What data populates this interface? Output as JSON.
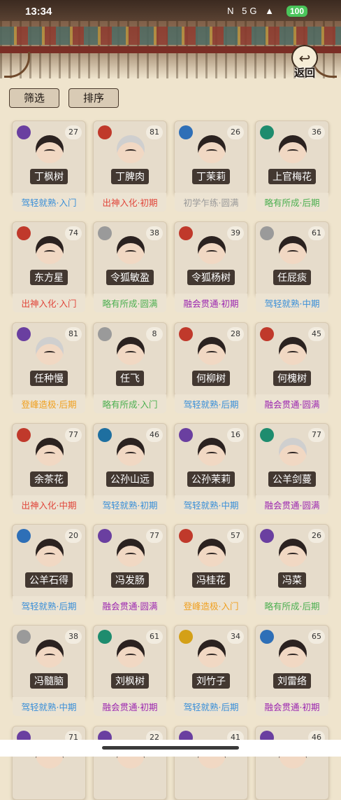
{
  "status": {
    "time": "13:34",
    "icons": "N  5G  ▲",
    "battery": "100"
  },
  "back": {
    "label": "返回",
    "icon": "back-arrow-icon"
  },
  "controls": {
    "filter": "筛选",
    "sort": "排序"
  },
  "colors": {
    "初学乍练": "#999999",
    "略有所成": "#4caf50",
    "驾轻就熟": "#3a8fd8",
    "融会贯通": "#9c27b0",
    "出神入化": "#e0453a",
    "登峰造极": "#f0a020"
  },
  "cards": [
    {
      "name": "丁枫树",
      "level": "27",
      "rank": "驾轻就熟·入门",
      "color": "#3a8fd8",
      "badge": "#6a3fa0",
      "hair": "dark"
    },
    {
      "name": "丁脾肉",
      "level": "81",
      "rank": "出神入化·初期",
      "color": "#e0453a",
      "badge": "#c0392b",
      "hair": "silver"
    },
    {
      "name": "丁茉莉",
      "level": "26",
      "rank": "初学乍练·圆满",
      "color": "#999999",
      "badge": "#2e6fb7",
      "hair": "dark"
    },
    {
      "name": "上官梅花",
      "level": "36",
      "rank": "略有所成·后期",
      "color": "#4caf50",
      "badge": "#1e8c6e",
      "hair": "dark"
    },
    {
      "name": "东方星",
      "level": "74",
      "rank": "出神入化·入门",
      "color": "#e0453a",
      "badge": "#c0392b",
      "hair": "dark"
    },
    {
      "name": "令狐敏盈",
      "level": "38",
      "rank": "略有所成·圆满",
      "color": "#4caf50",
      "badge": "#9a9a9a",
      "hair": "dark"
    },
    {
      "name": "令狐杨树",
      "level": "39",
      "rank": "融会贯通·初期",
      "color": "#9c27b0",
      "badge": "#c0392b",
      "hair": "dark"
    },
    {
      "name": "任屁痰",
      "level": "61",
      "rank": "驾轻就熟·中期",
      "color": "#3a8fd8",
      "badge": "#9a9a9a",
      "hair": "dark"
    },
    {
      "name": "任种慢",
      "level": "81",
      "rank": "登峰造极·后期",
      "color": "#f0a020",
      "badge": "#6a3fa0",
      "hair": "silver"
    },
    {
      "name": "任飞",
      "level": "8",
      "rank": "略有所成·入门",
      "color": "#4caf50",
      "badge": "#9a9a9a",
      "hair": "dark"
    },
    {
      "name": "何柳树",
      "level": "28",
      "rank": "驾轻就熟·后期",
      "color": "#3a8fd8",
      "badge": "#c0392b",
      "hair": "dark"
    },
    {
      "name": "何槐树",
      "level": "45",
      "rank": "融会贯通·圆满",
      "color": "#9c27b0",
      "badge": "#c0392b",
      "hair": "dark"
    },
    {
      "name": "余茶花",
      "level": "77",
      "rank": "出神入化·中期",
      "color": "#e0453a",
      "badge": "#c0392b",
      "hair": "dark"
    },
    {
      "name": "公孙山远",
      "level": "46",
      "rank": "驾轻就熟·初期",
      "color": "#3a8fd8",
      "badge": "#1e6fa0",
      "hair": "dark"
    },
    {
      "name": "公孙茉莉",
      "level": "16",
      "rank": "驾轻就熟·中期",
      "color": "#3a8fd8",
      "badge": "#6a3fa0",
      "hair": "dark"
    },
    {
      "name": "公羊剑蔓",
      "level": "77",
      "rank": "融会贯通·圆满",
      "color": "#9c27b0",
      "badge": "#1e8c6e",
      "hair": "silver"
    },
    {
      "name": "公羊石得",
      "level": "20",
      "rank": "驾轻就熟·后期",
      "color": "#3a8fd8",
      "badge": "#2e6fb7",
      "hair": "dark"
    },
    {
      "name": "冯发肠",
      "level": "77",
      "rank": "融会贯通·圆满",
      "color": "#9c27b0",
      "badge": "#6a3fa0",
      "hair": "dark"
    },
    {
      "name": "冯桂花",
      "level": "57",
      "rank": "登峰造极·入门",
      "color": "#f0a020",
      "badge": "#c0392b",
      "hair": "dark"
    },
    {
      "name": "冯菜",
      "level": "26",
      "rank": "略有所成·后期",
      "color": "#4caf50",
      "badge": "#6a3fa0",
      "hair": "dark"
    },
    {
      "name": "冯髓脑",
      "level": "38",
      "rank": "驾轻就熟·中期",
      "color": "#3a8fd8",
      "badge": "#9a9a9a",
      "hair": "dark"
    },
    {
      "name": "刘枫树",
      "level": "61",
      "rank": "融会贯通·初期",
      "color": "#9c27b0",
      "badge": "#1e8c6e",
      "hair": "dark"
    },
    {
      "name": "刘竹子",
      "level": "34",
      "rank": "驾轻就熟·后期",
      "color": "#3a8fd8",
      "badge": "#d4a017",
      "hair": "dark"
    },
    {
      "name": "刘雷络",
      "level": "65",
      "rank": "融会贯通·初期",
      "color": "#9c27b0",
      "badge": "#2e6fb7",
      "hair": "dark"
    },
    {
      "name": "",
      "level": "71",
      "rank": "",
      "color": "#3a8fd8",
      "badge": "#6a3fa0",
      "hair": "dark"
    },
    {
      "name": "",
      "level": "22",
      "rank": "",
      "color": "#3a8fd8",
      "badge": "#6a3fa0",
      "hair": "dark"
    },
    {
      "name": "",
      "level": "41",
      "rank": "",
      "color": "#3a8fd8",
      "badge": "#6a3fa0",
      "hair": "dark"
    },
    {
      "name": "",
      "level": "46",
      "rank": "",
      "color": "#3a8fd8",
      "badge": "#6a3fa0",
      "hair": "dark"
    }
  ]
}
